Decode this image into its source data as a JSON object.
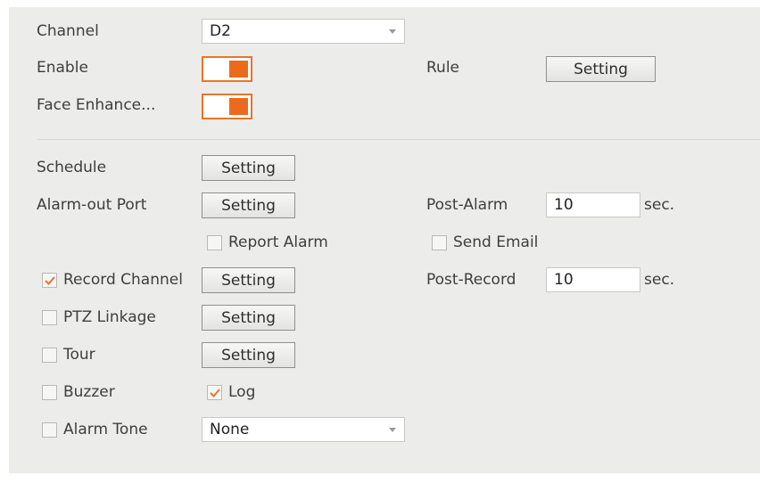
{
  "channel": {
    "label": "Channel",
    "value": "D2"
  },
  "enable": {
    "label": "Enable",
    "on": true
  },
  "rule": {
    "label": "Rule",
    "button": "Setting"
  },
  "face_enhance": {
    "label": "Face Enhance...",
    "on": true
  },
  "schedule": {
    "label": "Schedule",
    "button": "Setting"
  },
  "alarm_out": {
    "label": "Alarm-out Port",
    "button": "Setting"
  },
  "post_alarm": {
    "label": "Post-Alarm",
    "value": "10",
    "unit": "sec."
  },
  "report_alarm": {
    "label": "Report Alarm",
    "checked": false
  },
  "send_email": {
    "label": "Send Email",
    "checked": false
  },
  "record_channel": {
    "label": "Record Channel",
    "checked": true,
    "button": "Setting"
  },
  "post_record": {
    "label": "Post-Record",
    "value": "10",
    "unit": "sec."
  },
  "ptz_linkage": {
    "label": "PTZ Linkage",
    "checked": false,
    "button": "Setting"
  },
  "tour": {
    "label": "Tour",
    "checked": false,
    "button": "Setting"
  },
  "buzzer": {
    "label": "Buzzer",
    "checked": false
  },
  "log": {
    "label": "Log",
    "checked": true
  },
  "alarm_tone": {
    "label": "Alarm Tone",
    "checked": false,
    "value": "None"
  },
  "colors": {
    "accent": "#ec6a1c",
    "panel_bg": "#ececea",
    "check_color": "#e8752a"
  }
}
